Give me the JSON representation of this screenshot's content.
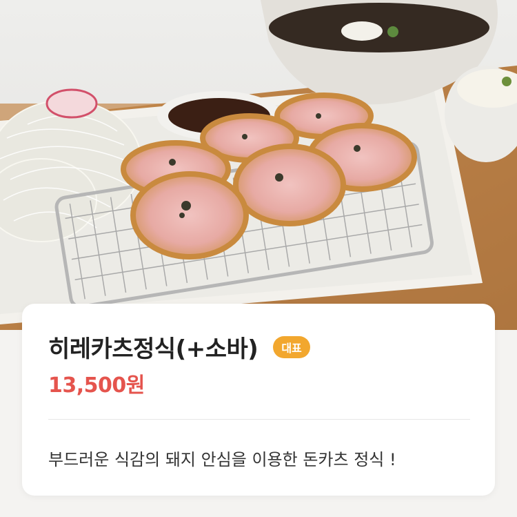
{
  "menu_item": {
    "name": "히레카츠정식(+소바)",
    "badge": "대표",
    "price": "13,500원",
    "description": "부드러운 식감의 돼지 안심을 이용한 돈카츠 정식 !"
  },
  "colors": {
    "price": "#e5544d",
    "badge_bg": "#f2a72e",
    "title": "#222222",
    "description": "#333333"
  }
}
